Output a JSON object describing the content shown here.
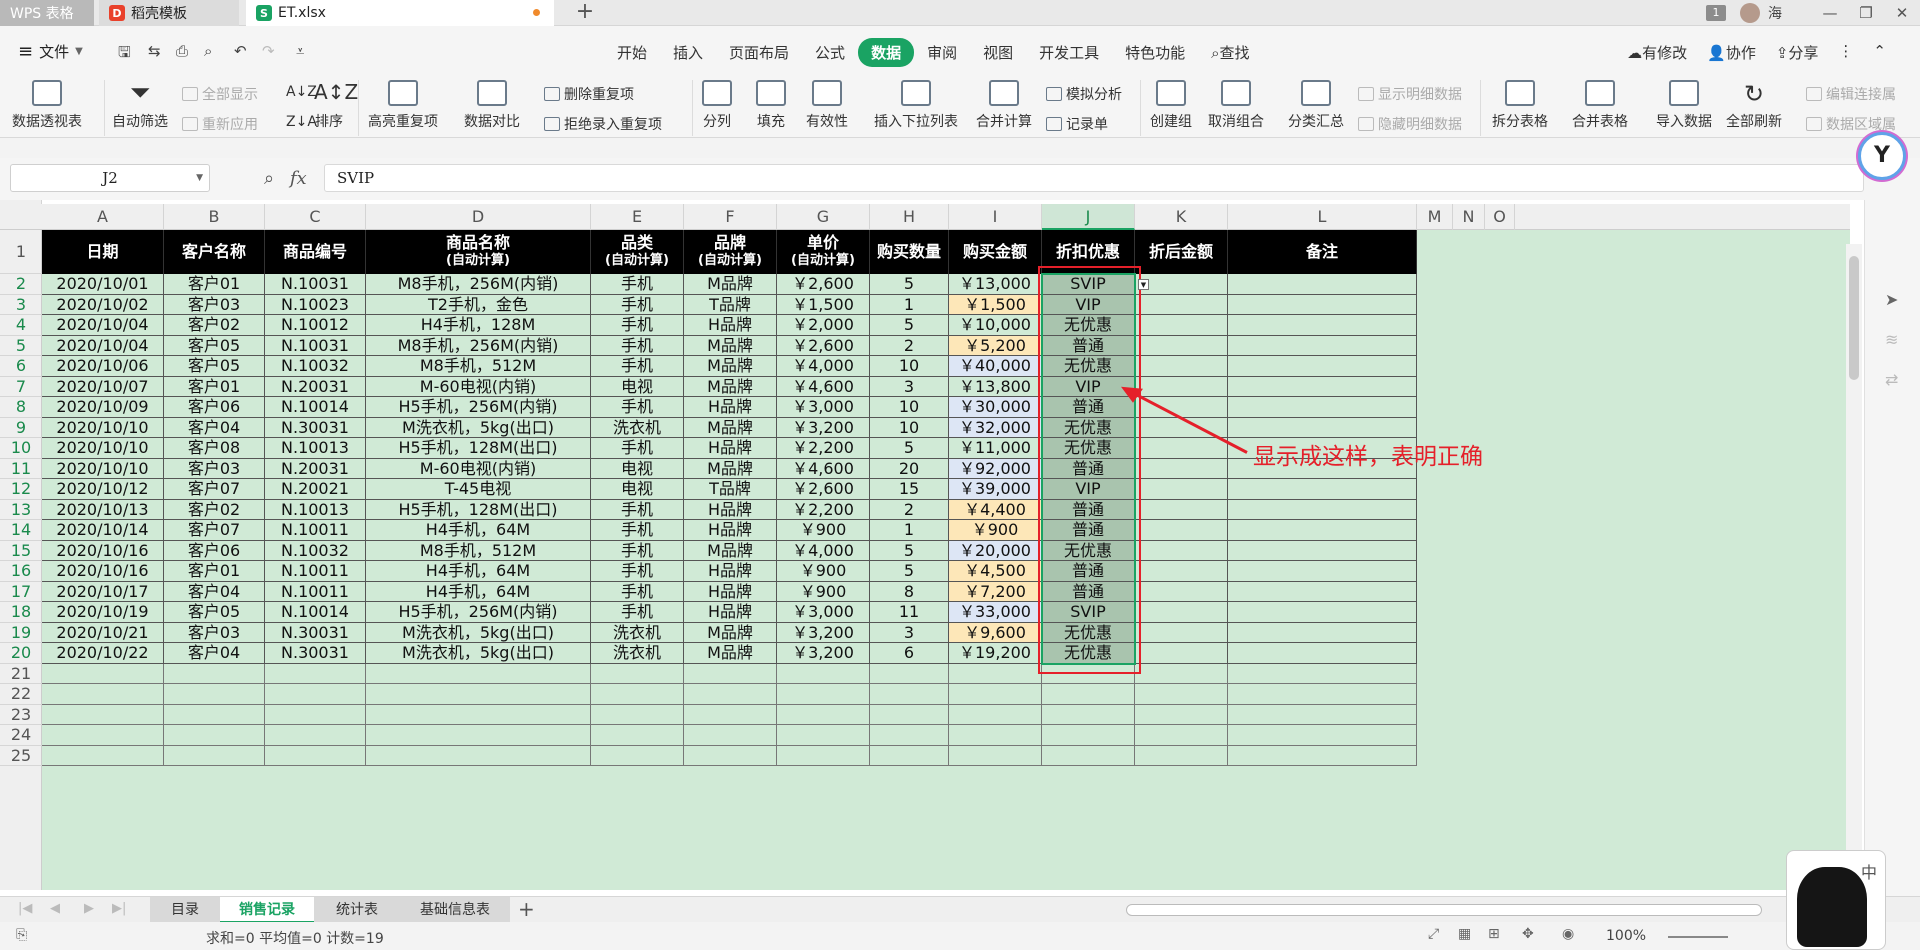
{
  "titlebar": {
    "app_tab": "WPS 表格",
    "template_tab": "稻壳模板",
    "file_tab": "ET.xlsx",
    "user_name": "海",
    "badge": "1"
  },
  "menubar": {
    "file_label": "文件",
    "tabs": [
      "开始",
      "插入",
      "页面布局",
      "公式",
      "数据",
      "审阅",
      "视图",
      "开发工具",
      "特色功能",
      "查找"
    ],
    "active_tab": "数据",
    "right": [
      "有修改",
      "协作",
      "分享"
    ]
  },
  "ribbon": {
    "pivot": "数据透视表",
    "autofilter": "自动筛选",
    "show_all": "全部显示",
    "reapply": "重新应用",
    "sort": "排序",
    "highlight_dup": "高亮重复项",
    "compare": "数据对比",
    "remove_dup": "删除重复项",
    "reject_dup": "拒绝录入重复项",
    "split_col": "分列",
    "fill": "填充",
    "validity": "有效性",
    "insert_dropdown": "插入下拉列表",
    "merge_calc": "合并计算",
    "simulate": "模拟分析",
    "record_form": "记录单",
    "create_group": "创建组",
    "ungroup": "取消组合",
    "subtotal": "分类汇总",
    "show_detail": "显示明细数据",
    "hide_detail": "隐藏明细数据",
    "split_table": "拆分表格",
    "merge_table": "合并表格",
    "import_data": "导入数据",
    "refresh_all": "全部刷新",
    "edit_link": "编辑连接属",
    "data_region": "数据区域属"
  },
  "formula_bar": {
    "name_box": "J2",
    "fx": "fx",
    "formula": "SVIP"
  },
  "columns": [
    "A",
    "B",
    "C",
    "D",
    "E",
    "F",
    "G",
    "H",
    "I",
    "J",
    "K",
    "L",
    "M",
    "N",
    "O"
  ],
  "headers": [
    {
      "main": "日期",
      "sub": ""
    },
    {
      "main": "客户名称",
      "sub": ""
    },
    {
      "main": "商品编号",
      "sub": ""
    },
    {
      "main": "商品名称",
      "sub": "(自动计算)"
    },
    {
      "main": "品类",
      "sub": "(自动计算)"
    },
    {
      "main": "品牌",
      "sub": "(自动计算)"
    },
    {
      "main": "单价",
      "sub": "(自动计算)"
    },
    {
      "main": "购买数量",
      "sub": ""
    },
    {
      "main": "购买金额",
      "sub": ""
    },
    {
      "main": "折扣优惠",
      "sub": ""
    },
    {
      "main": "折后金额",
      "sub": ""
    },
    {
      "main": "备注",
      "sub": ""
    }
  ],
  "rows": [
    [
      "2020/10/01",
      "客户01",
      "N.10031",
      "M8手机，256M(内销)",
      "手机",
      "M品牌",
      "￥2,600",
      "5",
      "￥13,000",
      "SVIP"
    ],
    [
      "2020/10/02",
      "客户03",
      "N.10023",
      "T2手机，金色",
      "手机",
      "T品牌",
      "￥1,500",
      "1",
      "￥1,500",
      "VIP"
    ],
    [
      "2020/10/04",
      "客户02",
      "N.10012",
      "H4手机，128M",
      "手机",
      "H品牌",
      "￥2,000",
      "5",
      "￥10,000",
      "无优惠"
    ],
    [
      "2020/10/04",
      "客户05",
      "N.10031",
      "M8手机，256M(内销)",
      "手机",
      "M品牌",
      "￥2,600",
      "2",
      "￥5,200",
      "普通"
    ],
    [
      "2020/10/06",
      "客户05",
      "N.10032",
      "M8手机，512M",
      "手机",
      "M品牌",
      "￥4,000",
      "10",
      "￥40,000",
      "无优惠"
    ],
    [
      "2020/10/07",
      "客户01",
      "N.20031",
      "M-60电视(内销)",
      "电视",
      "M品牌",
      "￥4,600",
      "3",
      "￥13,800",
      "VIP"
    ],
    [
      "2020/10/09",
      "客户06",
      "N.10014",
      "H5手机，256M(内销)",
      "手机",
      "H品牌",
      "￥3,000",
      "10",
      "￥30,000",
      "普通"
    ],
    [
      "2020/10/10",
      "客户04",
      "N.30031",
      "M洗衣机，5kg(出口)",
      "洗衣机",
      "M品牌",
      "￥3,200",
      "10",
      "￥32,000",
      "无优惠"
    ],
    [
      "2020/10/10",
      "客户08",
      "N.10013",
      "H5手机，128M(出口)",
      "手机",
      "H品牌",
      "￥2,200",
      "5",
      "￥11,000",
      "无优惠"
    ],
    [
      "2020/10/10",
      "客户03",
      "N.20031",
      "M-60电视(内销)",
      "电视",
      "M品牌",
      "￥4,600",
      "20",
      "￥92,000",
      "普通"
    ],
    [
      "2020/10/12",
      "客户07",
      "N.20021",
      "T-45电视",
      "电视",
      "T品牌",
      "￥2,600",
      "15",
      "￥39,000",
      "VIP"
    ],
    [
      "2020/10/13",
      "客户02",
      "N.10013",
      "H5手机，128M(出口)",
      "手机",
      "H品牌",
      "￥2,200",
      "2",
      "￥4,400",
      "普通"
    ],
    [
      "2020/10/14",
      "客户07",
      "N.10011",
      "H4手机，64M",
      "手机",
      "H品牌",
      "￥900",
      "1",
      "￥900",
      "普通"
    ],
    [
      "2020/10/16",
      "客户06",
      "N.10032",
      "M8手机，512M",
      "手机",
      "M品牌",
      "￥4,000",
      "5",
      "￥20,000",
      "无优惠"
    ],
    [
      "2020/10/16",
      "客户01",
      "N.10011",
      "H4手机，64M",
      "手机",
      "H品牌",
      "￥900",
      "5",
      "￥4,500",
      "普通"
    ],
    [
      "2020/10/17",
      "客户04",
      "N.10011",
      "H4手机，64M",
      "手机",
      "H品牌",
      "￥900",
      "8",
      "￥7,200",
      "普通"
    ],
    [
      "2020/10/19",
      "客户05",
      "N.10014",
      "H5手机，256M(内销)",
      "手机",
      "H品牌",
      "￥3,000",
      "11",
      "￥33,000",
      "SVIP"
    ],
    [
      "2020/10/21",
      "客户03",
      "N.30031",
      "M洗衣机，5kg(出口)",
      "洗衣机",
      "M品牌",
      "￥3,200",
      "3",
      "￥9,600",
      "无优惠"
    ],
    [
      "2020/10/22",
      "客户04",
      "N.30031",
      "M洗衣机，5kg(出口)",
      "洗衣机",
      "M品牌",
      "￥3,200",
      "6",
      "￥19,200",
      "无优惠"
    ]
  ],
  "amount_tint": [
    "",
    "y",
    "",
    "y",
    "b",
    "",
    "b",
    "b",
    "",
    "b",
    "b",
    "y",
    "y",
    "b",
    "y",
    "y",
    "b",
    "y",
    ""
  ],
  "row_numbers": [
    "1",
    "2",
    "3",
    "4",
    "5",
    "6",
    "7",
    "8",
    "9",
    "10",
    "11",
    "12",
    "13",
    "14",
    "15",
    "16",
    "17",
    "18",
    "19",
    "20",
    "21",
    "22",
    "23",
    "24",
    "25"
  ],
  "annotation": "显示成这样，表明正确",
  "sheet_tabs": [
    "目录",
    "销售记录",
    "统计表",
    "基础信息表"
  ],
  "active_sheet": "销售记录",
  "status": {
    "stats": "求和=0  平均值=0  计数=19",
    "zoom": "100%"
  },
  "ime_label": "中",
  "colors": {
    "accent": "#1aa363",
    "annotation": "#e5202a",
    "sheet_bg": "#d0ead6"
  }
}
